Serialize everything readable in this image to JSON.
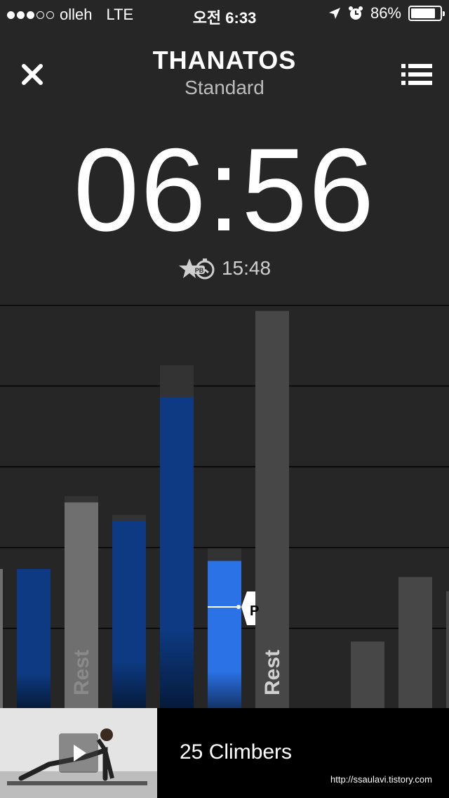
{
  "status_bar": {
    "carrier": "olleh",
    "network": "LTE",
    "time": "오전 6:33",
    "battery": "86%"
  },
  "header": {
    "title": "THANATOS",
    "subtitle": "Standard"
  },
  "timer": {
    "elapsed": "06:56",
    "personal_best": "15:48"
  },
  "chart": {
    "rest_label": "Rest",
    "marker_label": "P"
  },
  "chart_data": {
    "type": "bar",
    "title": "",
    "bars": [
      {
        "value": 0.345,
        "color": "#0d3a82",
        "grad": true
      },
      {
        "value": 0.51,
        "color": "#6f6f6f",
        "label": "Rest"
      },
      {
        "value": 0.465,
        "color": "#0d3a82",
        "grad": true
      },
      {
        "value": 0.77,
        "color": "#0d3a82",
        "grad": true
      },
      {
        "value": 0.365,
        "color": "#2a72e6",
        "grad": true,
        "current": true
      },
      {
        "value": 0.985,
        "color": "#474747",
        "label": "Rest"
      },
      {
        "value": 0.0,
        "color": "#474747"
      },
      {
        "value": 0.165,
        "color": "#474747"
      },
      {
        "value": 0.325,
        "color": "#474747"
      },
      {
        "value": 0.29,
        "color": "#474747"
      }
    ],
    "grid_lines": 5,
    "progress_marker": 0.28
  },
  "bottom": {
    "exercise": "25 Climbers",
    "watermark": "http://ssaulavi.tistory.com"
  },
  "icons": {
    "close": "close-icon",
    "menu": "list-menu-icon",
    "play": "play-icon",
    "pb": "stopwatch-pb-icon"
  },
  "colors": {
    "accent_blue": "#2a72e6",
    "dark_blue": "#0d3a82",
    "background": "#262626"
  }
}
